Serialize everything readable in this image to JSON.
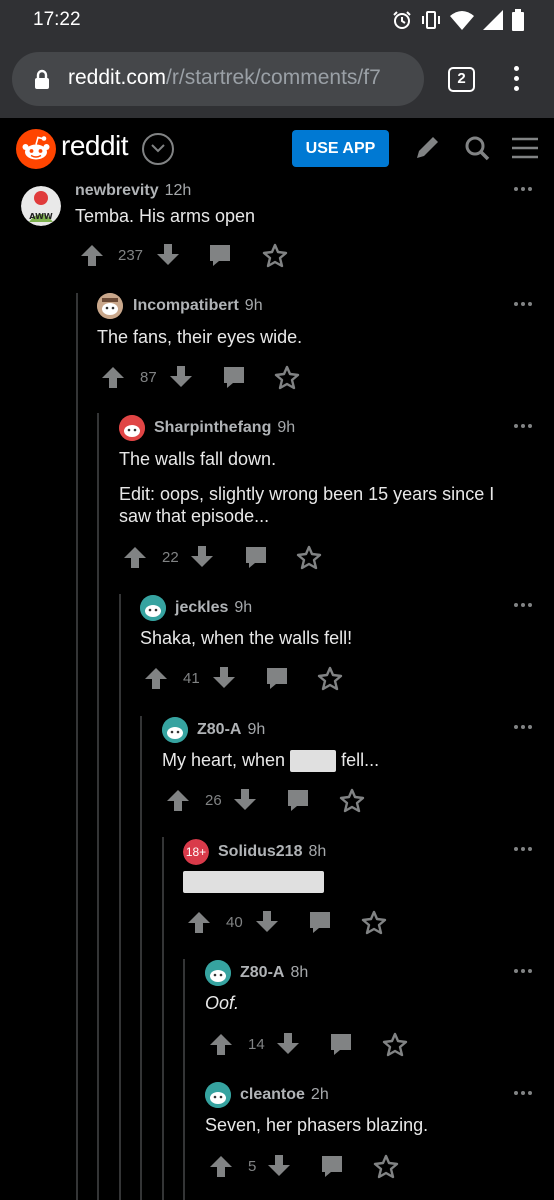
{
  "status": {
    "time": "17:22"
  },
  "url_bar": {
    "domain": "reddit.com",
    "path": "/r/startrek/comments/f7"
  },
  "browser": {
    "tab_count": "2"
  },
  "header": {
    "wordmark": "reddit",
    "use_app_label": "USE APP"
  },
  "comments": [
    {
      "author": "newbrevity",
      "age": "12h",
      "paragraphs": [
        "Temba. His arms open"
      ],
      "score": "237",
      "depth": 0,
      "avatar": "aww-avatar"
    },
    {
      "author": "Incompatibert",
      "age": "9h",
      "paragraphs": [
        "The fans, their eyes wide."
      ],
      "score": "87",
      "depth": 1,
      "avatar": "snoo-avatar"
    },
    {
      "author": "Sharpinthefang",
      "age": "9h",
      "paragraphs": [
        "The walls fall down.",
        "Edit: oops, slightly wrong been 15 years since I saw that episode..."
      ],
      "score": "22",
      "depth": 2,
      "avatar": "snoo-red-avatar"
    },
    {
      "author": "jeckles",
      "age": "9h",
      "paragraphs": [
        "Shaka, when the walls fell!"
      ],
      "score": "41",
      "depth": 3,
      "avatar": "snoo-teal-avatar"
    },
    {
      "author": "Z80-A",
      "age": "9h",
      "text_before": "My heart, when",
      "text_after": "fell...",
      "score": "26",
      "depth": 4,
      "avatar": "snoo-teal-avatar"
    },
    {
      "author": "Solidus218",
      "age": "8h",
      "score": "40",
      "depth": 5,
      "avatar": "nsfw-avatar",
      "avatar_label": "18+"
    },
    {
      "author": "Z80-A",
      "age": "8h",
      "paragraphs": [
        "Oof."
      ],
      "score": "14",
      "depth": 6,
      "avatar": "snoo-teal-avatar"
    },
    {
      "author": "cleantoe",
      "age": "2h",
      "paragraphs": [
        "Seven, her phasers blazing."
      ],
      "score": "5",
      "depth": 6,
      "avatar": "snoo-teal-avatar"
    }
  ],
  "colors": {
    "accent": "#0079d3",
    "reddit_orange": "#ff4500",
    "background": "#000000",
    "thread_line": "#343536",
    "muted": "#818384"
  }
}
